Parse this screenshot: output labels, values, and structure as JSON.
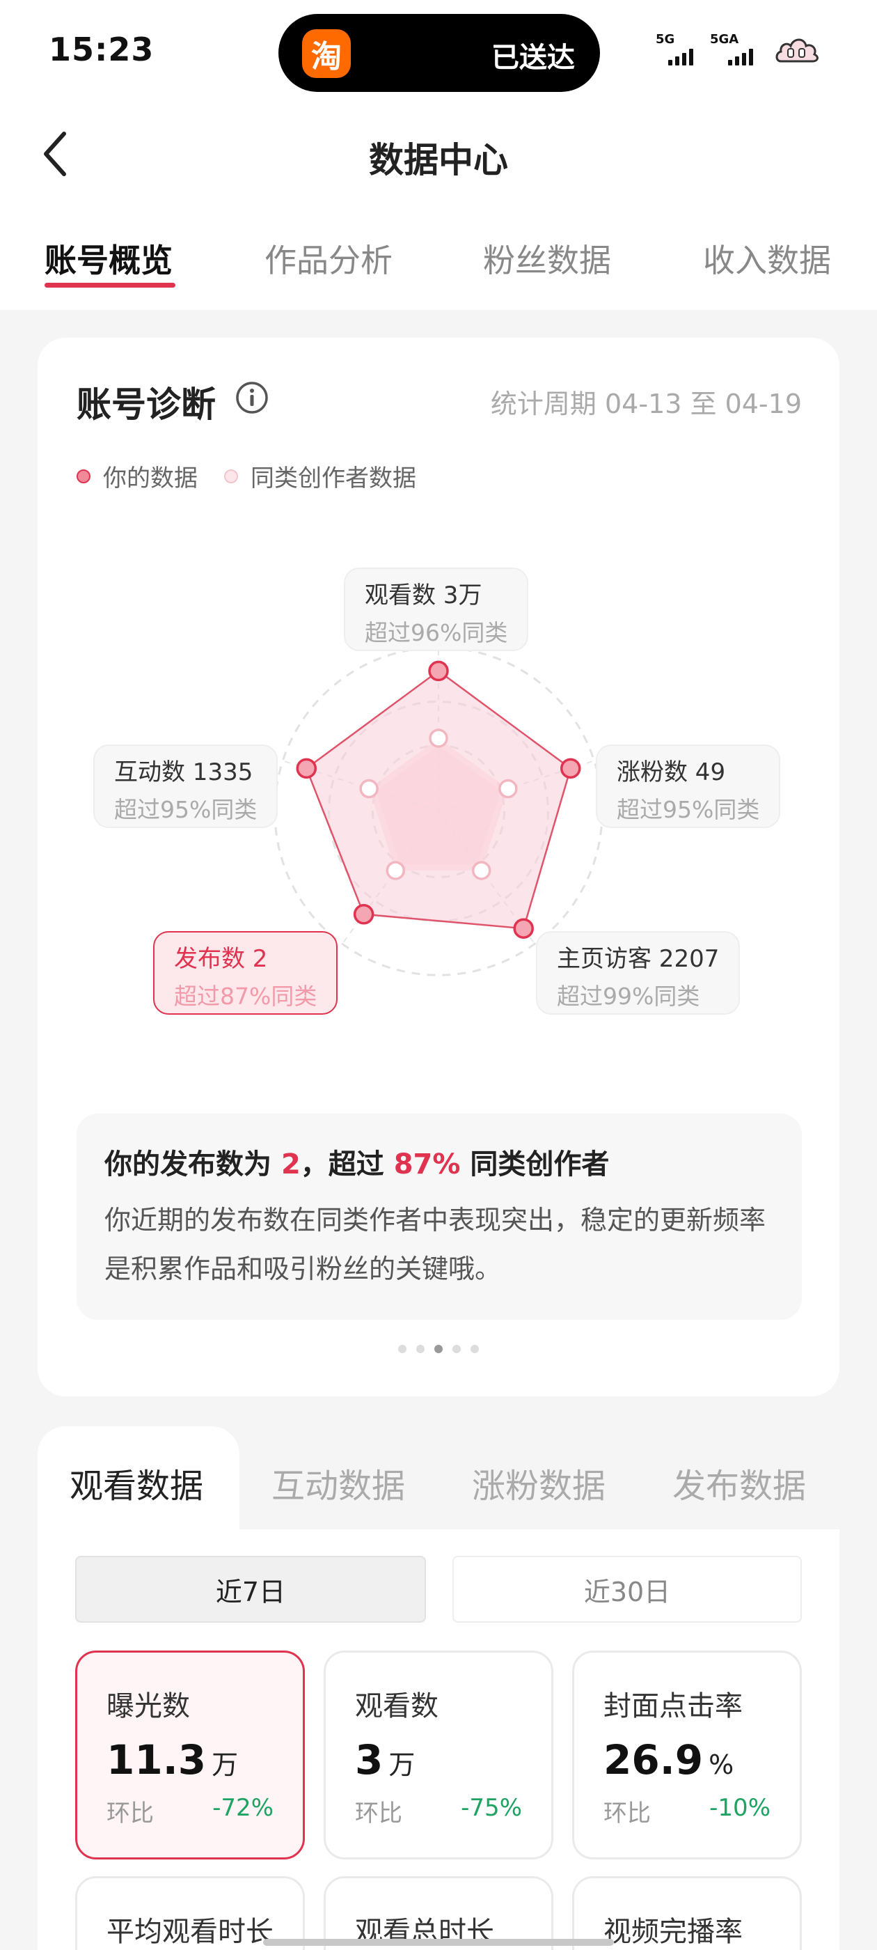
{
  "status": {
    "time": "15:23",
    "island_text": "已送达",
    "app_icon_char": "淘",
    "signal1_label": "5G",
    "signal2_label": "5GA"
  },
  "nav": {
    "title": "数据中心"
  },
  "tabs": [
    "账号概览",
    "作品分析",
    "粉丝数据",
    "收入数据"
  ],
  "diagnosis": {
    "title": "账号诊断",
    "period": "统计周期 04-13 至 04-19",
    "legend_mine": "你的数据",
    "legend_peer": "同类创作者数据",
    "axes": [
      {
        "title": "观看数 3万",
        "sub": "超过96%同类",
        "percentile": 96
      },
      {
        "title": "涨粉数 49",
        "sub": "超过95%同类",
        "percentile": 95
      },
      {
        "title": "主页访客 2207",
        "sub": "超过99%同类",
        "percentile": 99
      },
      {
        "title": "发布数 2",
        "sub": "超过87%同类",
        "percentile": 87
      },
      {
        "title": "互动数 1335",
        "sub": "超过95%同类",
        "percentile": 95
      }
    ],
    "insight_prefix": "你的发布数为 ",
    "insight_count": "2",
    "insight_middle": "，超过 ",
    "insight_percent": "87%",
    "insight_suffix": " 同类创作者",
    "insight_body": "你近期的发布数在同类作者中表现突出，稳定的更新频率是积累作品和吸引粉丝的关键哦。"
  },
  "colors": {
    "accent": "#e0334f",
    "positive": "#1ea362"
  },
  "stats": {
    "tabs": [
      "观看数据",
      "互动数据",
      "涨粉数据",
      "发布数据"
    ],
    "range_7": "近7日",
    "range_30": "近30日",
    "metrics": [
      {
        "label": "曝光数",
        "value": "11.3",
        "unit": "万",
        "compare_label": "环比",
        "delta": "-72%"
      },
      {
        "label": "观看数",
        "value": "3",
        "unit": "万",
        "compare_label": "环比",
        "delta": "-75%"
      },
      {
        "label": "封面点击率",
        "value": "26.9",
        "unit": "%",
        "compare_label": "环比",
        "delta": "-10%"
      }
    ],
    "metrics_row2": [
      "平均观看时长",
      "观看总时长",
      "视频完播率"
    ]
  }
}
